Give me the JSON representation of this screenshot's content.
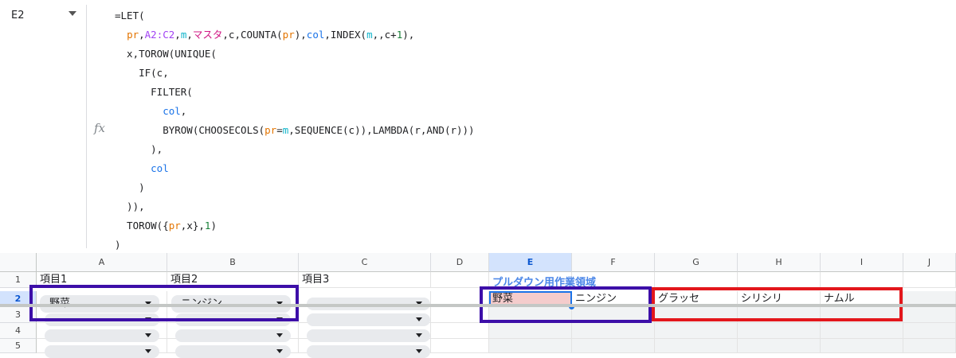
{
  "namebox": {
    "cell_ref": "E2"
  },
  "formula_bar": {
    "fx_label": "fx",
    "lines": [
      [
        {
          "t": "=LET("
        }
      ],
      [
        {
          "t": "  "
        },
        {
          "t": "pr",
          "c": "orange"
        },
        {
          "t": ","
        },
        {
          "t": "A2:C2",
          "c": "purple"
        },
        {
          "t": ","
        },
        {
          "t": "m",
          "c": "teal"
        },
        {
          "t": ","
        },
        {
          "t": "マスタ",
          "c": "pink"
        },
        {
          "t": ",c,COUNTA("
        },
        {
          "t": "pr",
          "c": "orange"
        },
        {
          "t": "),"
        },
        {
          "t": "col",
          "c": "blue"
        },
        {
          "t": ",INDEX("
        },
        {
          "t": "m",
          "c": "teal"
        },
        {
          "t": ",,c+"
        },
        {
          "t": "1",
          "c": "green"
        },
        {
          "t": "),"
        }
      ],
      [
        {
          "t": "  x,TOROW(UNIQUE("
        }
      ],
      [
        {
          "t": "    IF(c,"
        }
      ],
      [
        {
          "t": "      FILTER("
        }
      ],
      [
        {
          "t": "        "
        },
        {
          "t": "col",
          "c": "blue"
        },
        {
          "t": ","
        }
      ],
      [
        {
          "t": "        BYROW(CHOOSECOLS("
        },
        {
          "t": "pr",
          "c": "orange"
        },
        {
          "t": "="
        },
        {
          "t": "m",
          "c": "teal"
        },
        {
          "t": ",SEQUENCE(c)),LAMBDA(r,AND(r)))"
        }
      ],
      [
        {
          "t": "      ),"
        }
      ],
      [
        {
          "t": "      "
        },
        {
          "t": "col",
          "c": "blue"
        }
      ],
      [
        {
          "t": "    )"
        }
      ],
      [
        {
          "t": "  )),"
        }
      ],
      [
        {
          "t": "  TOROW({"
        },
        {
          "t": "pr",
          "c": "orange"
        },
        {
          "t": ",x},"
        },
        {
          "t": "1",
          "c": "green"
        },
        {
          "t": ")"
        }
      ],
      [
        {
          "t": ")"
        }
      ]
    ]
  },
  "columns": [
    "A",
    "B",
    "C",
    "D",
    "E",
    "F",
    "G",
    "H",
    "I",
    "J"
  ],
  "rows": [
    "1",
    "2",
    "3",
    "4",
    "5"
  ],
  "row1": {
    "a1": "項目1",
    "b1": "項目2",
    "c1": "項目3",
    "e1": "プルダウン用作業領域"
  },
  "row2": {
    "a2": "野菜",
    "b2": "ニンジン",
    "c2": "",
    "e2": "野菜",
    "f2": "ニンジン",
    "g2": "グラッセ",
    "h2": "シリシリ",
    "i2": "ナムル"
  },
  "colors": {
    "header_selected": "#d3e3fd",
    "selected_cell_fill": "#f4cccc",
    "selection_border": "#1a73e8",
    "purple_box": "#3d0fa8",
    "red_box": "#e3171c",
    "sheet_title_blue": "#4a86e8"
  }
}
